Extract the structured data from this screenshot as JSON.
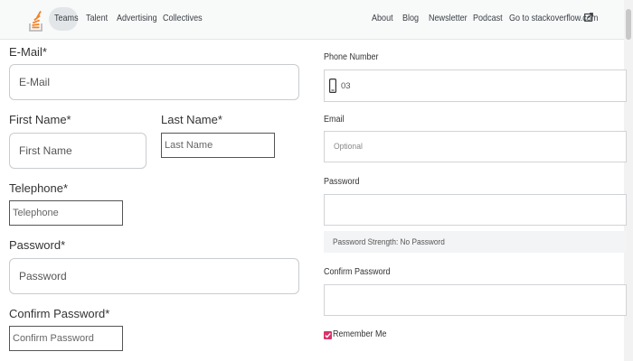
{
  "nav": {
    "logo": "stackoverflow-logo-icon",
    "items": [
      "Teams",
      "Talent",
      "Advertising",
      "Collectives"
    ],
    "right_items": [
      "About",
      "Blog",
      "Newsletter",
      "Podcast",
      "Go to stackoverflow.com"
    ],
    "external_icon": "external-link-icon"
  },
  "left_form": {
    "email_label": "E-Mail*",
    "email_placeholder": "E-Mail",
    "first_name_label": "First Name*",
    "first_name_placeholder": "First Name",
    "last_name_label": "Last Name*",
    "last_name_placeholder": "Last Name",
    "telephone_label": "Telephone*",
    "telephone_placeholder": "Telephone",
    "password_label": "Password*",
    "password_placeholder": "Password",
    "confirm_label": "Confirm Password*",
    "confirm_placeholder": "Confirm Password"
  },
  "right_form": {
    "phone_label": "Phone Number",
    "phone_value": "03",
    "phone_icon": "mobile-phone-icon",
    "email_label": "Email",
    "email_placeholder": "Optional",
    "password_label": "Password",
    "password_strength": "Password Strength: No Password",
    "confirm_label": "Confirm Password",
    "remember_label": "Remember Me",
    "remember_checked": true
  },
  "colors": {
    "accent": "#f48024",
    "checkbox": "#d9346b",
    "nav_bg": "#f8f9f9"
  }
}
